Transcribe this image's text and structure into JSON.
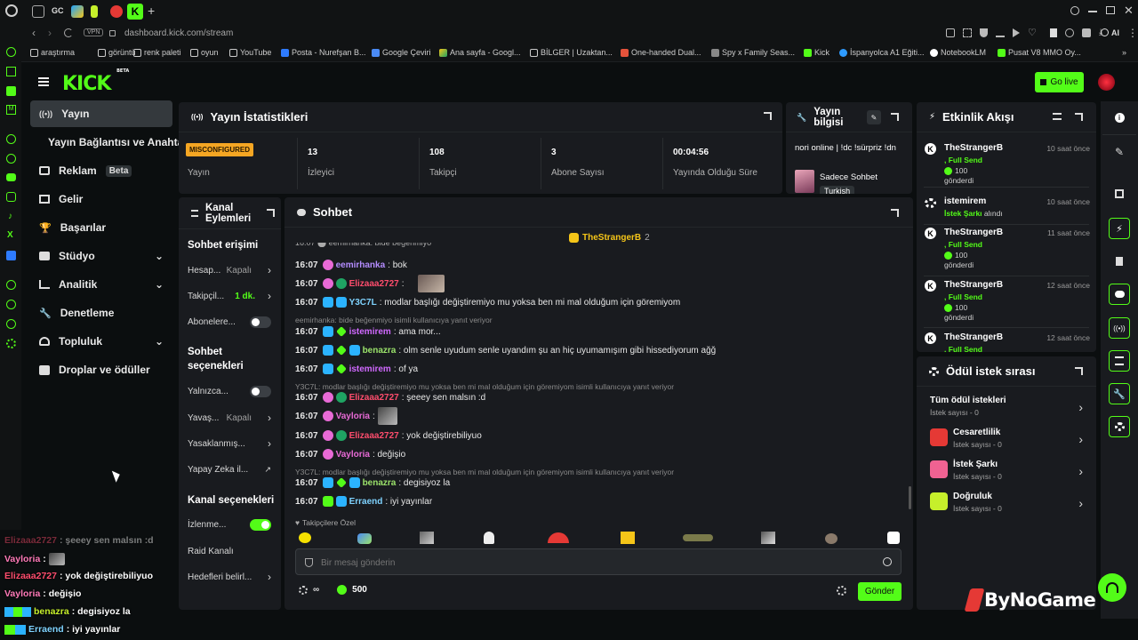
{
  "browser": {
    "url": "dashboard.kick.com/stream",
    "vpn_label": "VPN",
    "ai_label": "AI",
    "tab_gc": "GC",
    "bookmarks": [
      "araştırma",
      "görüntü",
      "renk paleti",
      "oyun",
      "YouTube",
      "Posta - Nurefşan B...",
      "Google Çeviri",
      "Ana sayfa - Googl...",
      "BİLGER | Uzaktan...",
      "One-handed Dual...",
      "Spy x Family Seas...",
      "Kick",
      "İspanyolca A1 Eğiti...",
      "NotebookLM",
      "Pusat V8 MMO Oy..."
    ]
  },
  "header": {
    "logo": "KICK",
    "logo_beta": "BETA",
    "go_live": "Go live"
  },
  "nav": {
    "items": [
      {
        "label": "Yayın",
        "active": true
      },
      {
        "label": "Yayın Bağlantısı ve Anahtarı"
      },
      {
        "label": "Reklam",
        "badge": "Beta"
      },
      {
        "label": "Gelir"
      },
      {
        "label": "Başarılar"
      },
      {
        "label": "Stüdyo"
      },
      {
        "label": "Analitik"
      },
      {
        "label": "Denetleme"
      },
      {
        "label": "Topluluk"
      },
      {
        "label": "Droplar ve ödüller"
      }
    ]
  },
  "stats": {
    "title": "Yayın İstatistikleri",
    "status_badge": "MISCONFIGURED",
    "status_caption": "Yayın",
    "items": [
      {
        "value": "13",
        "caption": "İzleyici"
      },
      {
        "value": "108",
        "caption": "Takipçi"
      },
      {
        "value": "3",
        "caption": "Abone Sayısı"
      },
      {
        "value": "00:04:56",
        "caption": "Yayında Olduğu Süre"
      }
    ]
  },
  "stream_info": {
    "title": "Yayın bilgisi",
    "stream_title": "nori online | !dc !sürpriz !dn",
    "category": "Sadece Sohbet",
    "language": "Turkish"
  },
  "channel_actions": {
    "title": "Kanal Eylemleri",
    "sections": [
      {
        "heading": "Sohbet erişimi"
      },
      {
        "heading": "Sohbet seçenekleri"
      },
      {
        "heading": "Kanal seçenekleri"
      }
    ],
    "rows": {
      "hesap": {
        "label": "Hesap...",
        "value": "Kapalı"
      },
      "takipci": {
        "label": "Takipçil...",
        "value": "1 dk."
      },
      "abone": {
        "label": "Abonelere..."
      },
      "yalniz": {
        "label": "Yalnızca..."
      },
      "yavas": {
        "label": "Yavaş...",
        "value": "Kapalı"
      },
      "yasak": {
        "label": "Yasaklanmış..."
      },
      "yapay": {
        "label": "Yapay Zeka il..."
      },
      "izleme": {
        "label": "İzlenme..."
      },
      "raid": {
        "label": "Raid Kanalı"
      },
      "hedef": {
        "label": "Hedefleri belirl..."
      }
    }
  },
  "chat": {
    "title": "Sohbet",
    "pinned_user": "TheStrangerB",
    "pinned_count": "2",
    "messages": [
      {
        "time": "16:07",
        "user": "eemirhanka",
        "color": "#b48cff",
        "text": ": bok"
      },
      {
        "time": "16:07",
        "user": "Elizaaa2727",
        "color": "#ff4d6d",
        "text": ":",
        "emote": true
      },
      {
        "time": "16:07",
        "user": "Y3C7L",
        "color": "#7fd3ff",
        "text": ": modlar başlığı değiştiremiyo mu yoksa ben mi mal olduğum için göremiyom"
      },
      {
        "time": "16:07",
        "user": "istemirem",
        "color": "#d069ff",
        "text": ": ama mor..."
      },
      {
        "time": "16:07",
        "user": "benazra",
        "color": "#9be36b",
        "text": ": olm senle uyudum senle uyandım şu an hiç uyumamışım gibi hissediyorum ağğ"
      },
      {
        "time": "16:07",
        "user": "istemirem",
        "color": "#d069ff",
        "text": ": of ya"
      },
      {
        "time": "16:07",
        "user": "Elizaaa2727",
        "color": "#ff4d6d",
        "text": ": şeeey sen malsın :d"
      },
      {
        "time": "16:07",
        "user": "Vayloria",
        "color": "#e86ad6",
        "text": ":",
        "emote": true
      },
      {
        "time": "16:07",
        "user": "Elizaaa2727",
        "color": "#ff4d6d",
        "text": ": yok değiştirebiliyuo"
      },
      {
        "time": "16:07",
        "user": "Vayloria",
        "color": "#e86ad6",
        "text": ": değişio"
      },
      {
        "time": "16:07",
        "user": "benazra",
        "color": "#9be36b",
        "text": ": degisiyoz la"
      },
      {
        "time": "16:07",
        "user": "Erraend",
        "color": "#7fd3ff",
        "text": ": iyi yayınlar"
      }
    ],
    "reply1": "eemirhanka: bide beğenmiyo isimli kullanıcıya yanıt veriyor",
    "reply2": "Y3C7L: modlar başlığı değiştiremiyo mu yoksa ben mi mal olduğum için göremiyom isimli kullanıcıya yanıt veriyor",
    "reply3": "Y3C7L: modlar başlığı değiştiremiyo mu yoksa ben mi mal olduğum için göremiyom isimli kullanıcıya yanıt veriyor",
    "followers_only": "Takipçilere Özel",
    "input_placeholder": "Bir mesaj gönderin",
    "points": "500",
    "send": "Gönder"
  },
  "activity": {
    "title": "Etkinlik Akışı",
    "items": [
      {
        "name": "TheStrangerB",
        "time": "10 saat önce",
        "action": ", Full Send",
        "amount": "100",
        "sent": "gönderdi"
      },
      {
        "name": "istemirem",
        "time": "10 saat önce",
        "action": "İstek Şarkı",
        "extra": "alındı"
      },
      {
        "name": "TheStrangerB",
        "time": "11 saat önce",
        "action": ", Full Send",
        "amount": "100",
        "sent": "gönderdi"
      },
      {
        "name": "TheStrangerB",
        "time": "12 saat önce",
        "action": ", Full Send",
        "amount": "100",
        "sent": "gönderdi"
      },
      {
        "name": "TheStrangerB",
        "time": "12 saat önce",
        "action": ", Full Send"
      }
    ]
  },
  "rewards": {
    "title": "Ödül istek sırası",
    "all": "Tüm ödül istekleri",
    "all_count": "İstek sayısı - 0",
    "items": [
      {
        "name": "Cesaretlilik",
        "count": "İstek sayısı - 0",
        "color": "#e53935"
      },
      {
        "name": "İstek Şarkı",
        "count": "İstek sayısı - 0",
        "color": "#f06292"
      },
      {
        "name": "Doğruluk",
        "count": "İstek sayısı - 0",
        "color": "#c6ef2b"
      }
    ]
  },
  "overlay": {
    "lines": [
      {
        "user": "Elizaaa2727",
        "text": ": şeeey sen malsın :d",
        "color": "#ff4d6d",
        "faded": true
      },
      {
        "user": "Vayloria",
        "text": " :",
        "color": "#ff7ab8"
      },
      {
        "user": "Elizaaa2727",
        "text": ": yok değiştirebiliyuo",
        "color": "#ff4d6d"
      },
      {
        "user": "Vayloria",
        "text": ": değişio",
        "color": "#ff7ab8"
      },
      {
        "user": "benazra",
        "text": ": degisiyoz la",
        "color": "#c6ef2b"
      },
      {
        "user": "Erraend",
        "text": ": iyi yayınlar",
        "color": "#7fd3ff"
      }
    ]
  },
  "watermark": "ByNoGame",
  "colors": {
    "accent": "#53fc18",
    "panel": "#191b1f",
    "bg": "#0b0e0f",
    "misconfigured": "#f5a623"
  }
}
